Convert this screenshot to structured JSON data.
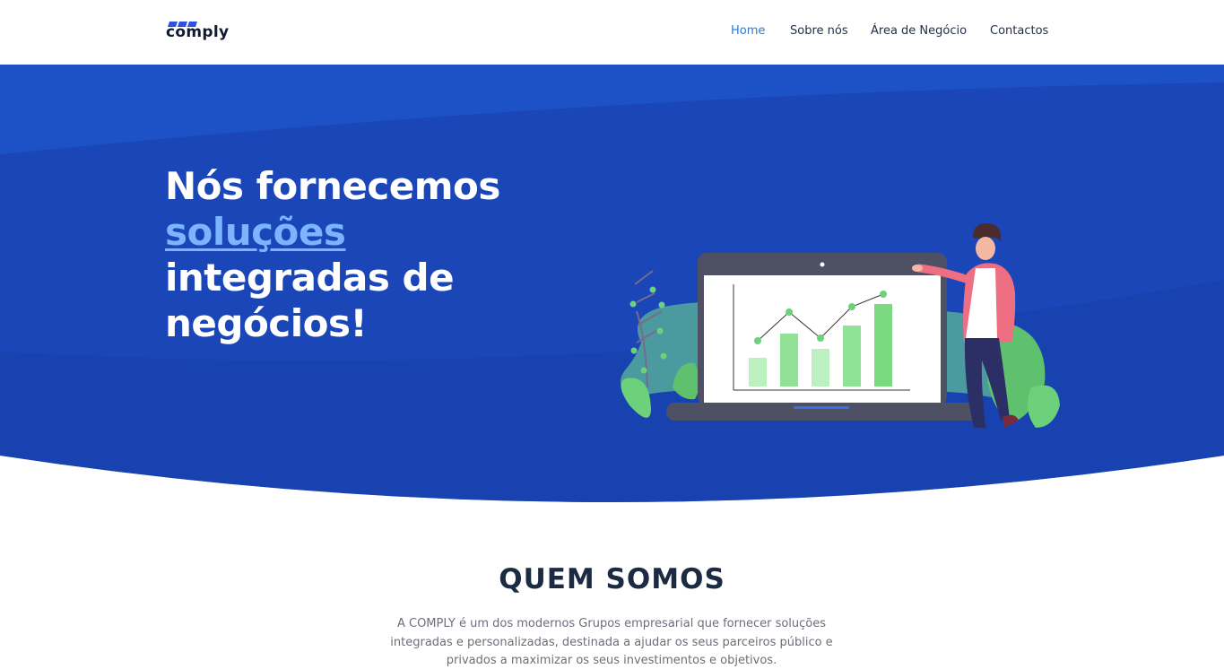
{
  "brand": {
    "logo_text": "comply",
    "colors": {
      "logo_bar": "#2a52e0",
      "logo_text": "#111a33"
    }
  },
  "nav": {
    "items": [
      {
        "label": "Home",
        "active": true
      },
      {
        "label": "Sobre nós",
        "active": false
      },
      {
        "label": "Área de Negócio",
        "active": false
      },
      {
        "label": "Contactos",
        "active": false
      }
    ]
  },
  "hero": {
    "title_line1": "Nós fornecemos",
    "title_highlight": "soluções",
    "title_line3": "integradas de",
    "title_line4": "negócios!",
    "colors": {
      "background": "#1a46b8",
      "highlight": "#7db4ff"
    },
    "illustration": "presenter-with-growth-chart-illustration"
  },
  "about": {
    "title": "QUEM SOMOS",
    "text": "A COMPLY é um dos modernos Grupos empresarial que fornecer soluções integradas e personalizadas, destinada a ajudar os seus parceiros público e privados a maximizar os seus investimentos e objetivos."
  }
}
